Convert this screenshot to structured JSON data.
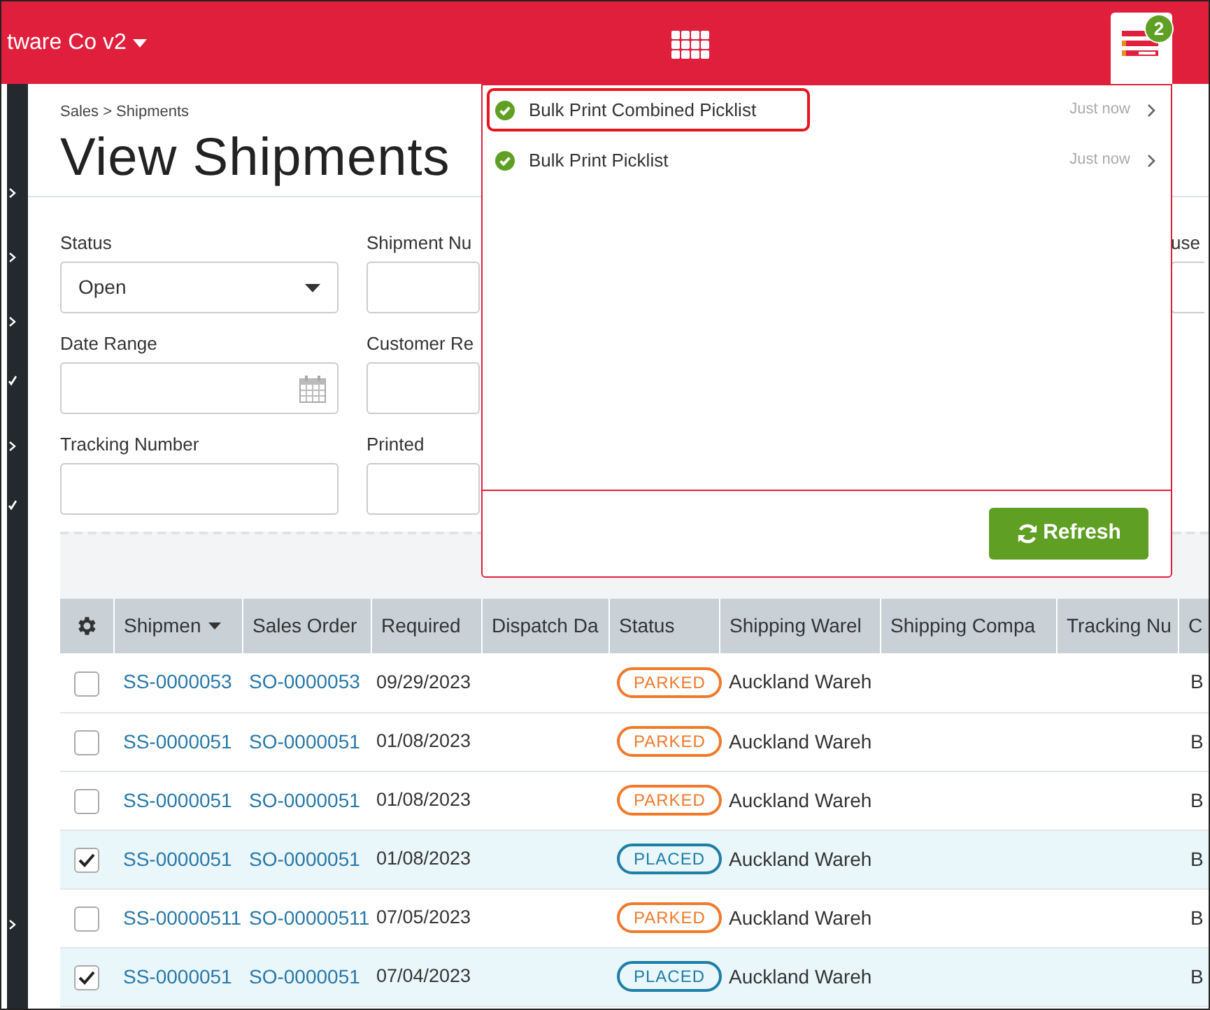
{
  "header": {
    "company": "tware Co v2",
    "notification_count": "2"
  },
  "breadcrumb": "Sales > Shipments",
  "page_title": "View Shipments",
  "filters": {
    "column_1": [
      {
        "label": "Status",
        "kind": "select",
        "value": "Open"
      },
      {
        "label": "Date Range",
        "kind": "date"
      },
      {
        "label": "Tracking Number",
        "kind": "text"
      }
    ],
    "column_2": [
      {
        "label": "Shipment Nu",
        "kind": "text"
      },
      {
        "label": "Customer Re",
        "kind": "text"
      },
      {
        "label": "Printed",
        "kind": "text"
      }
    ],
    "column_3": [
      {
        "label": "use",
        "kind": "text"
      }
    ]
  },
  "table": {
    "columns": [
      "Shipmen",
      "Sales Order",
      "Required",
      "Dispatch Da",
      "Status",
      "Shipping Warel",
      "Shipping Compa",
      "Tracking Nu",
      "C"
    ],
    "rows": [
      {
        "checked": false,
        "shipment": "SS-0000053",
        "sales_order": "SO-0000053",
        "required": "09/29/2023",
        "status": {
          "label": "PARKED",
          "kind": "parked"
        },
        "warehouse": "Auckland Wareh",
        "column_9": "B"
      },
      {
        "checked": false,
        "shipment": "SS-0000051",
        "sales_order": "SO-0000051",
        "required": "01/08/2023",
        "status": {
          "label": "PARKED",
          "kind": "parked"
        },
        "warehouse": "Auckland Wareh",
        "column_9": "B"
      },
      {
        "checked": false,
        "shipment": "SS-0000051",
        "sales_order": "SO-0000051",
        "required": "01/08/2023",
        "status": {
          "label": "PARKED",
          "kind": "parked"
        },
        "warehouse": "Auckland Wareh",
        "column_9": "B"
      },
      {
        "checked": true,
        "shipment": "SS-0000051",
        "sales_order": "SO-0000051",
        "required": "01/08/2023",
        "status": {
          "label": "PLACED",
          "kind": "placed"
        },
        "warehouse": "Auckland Wareh",
        "column_9": "B"
      },
      {
        "checked": false,
        "shipment": "SS-00000511",
        "sales_order": "SO-00000511",
        "required": "07/05/2023",
        "status": {
          "label": "PARKED",
          "kind": "parked"
        },
        "warehouse": "Auckland Wareh",
        "column_9": "B"
      },
      {
        "checked": true,
        "shipment": "SS-0000051",
        "sales_order": "SO-0000051",
        "required": "07/04/2023",
        "status": {
          "label": "PLACED",
          "kind": "placed"
        },
        "warehouse": "Auckland Wareh",
        "column_9": "B"
      }
    ]
  },
  "notifications": {
    "items": [
      {
        "title": "Bulk Print Combined Picklist",
        "time": "Just now",
        "highlighted": true
      },
      {
        "title": "Bulk Print Picklist",
        "time": "Just now",
        "highlighted": false
      }
    ],
    "refresh_button": "Refresh"
  }
}
